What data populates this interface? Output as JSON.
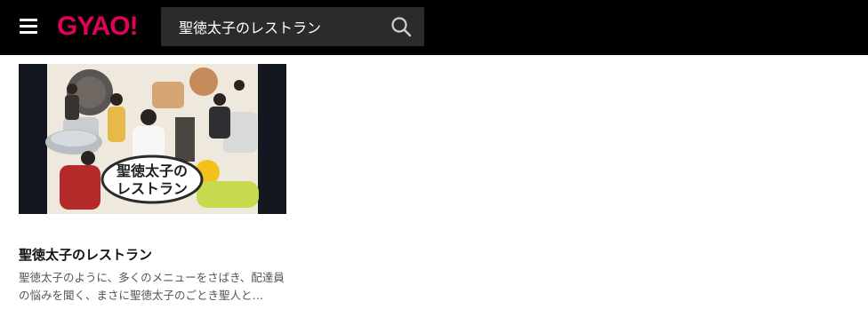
{
  "header": {
    "logo_text": "GYAO!",
    "logo_color": "#e2005a",
    "menu_icon": "hamburger-menu-icon",
    "search": {
      "value": "聖徳太子のレストラン",
      "placeholder": "",
      "icon": "search-icon"
    }
  },
  "results": [
    {
      "title": "聖徳太子のレストラン",
      "description": "聖徳太子のように、多くのメニューをさばき、配達員の悩みを聞く、まさに聖徳太子のごとき聖人と…",
      "thumbnail": {
        "logo_line1": "聖徳太子の",
        "logo_line2": "レストラン"
      }
    }
  ],
  "colors": {
    "header_bg": "#000000",
    "search_bg": "#2b2b2b",
    "thumbnail_side_bg": "#121720"
  }
}
